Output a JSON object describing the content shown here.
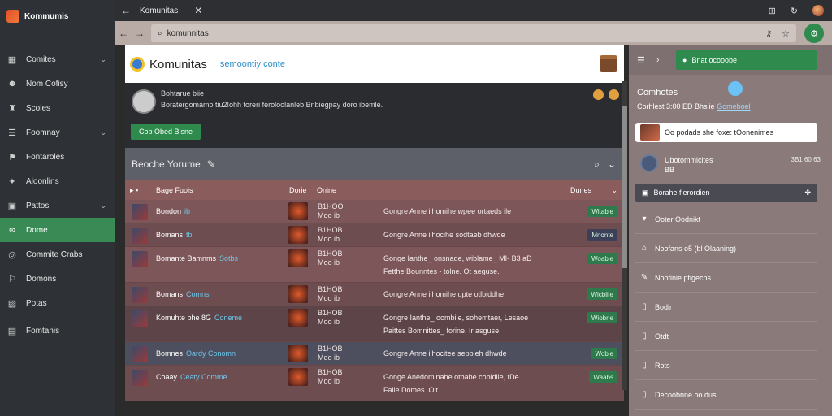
{
  "sidebar": {
    "brand": "Kommumis",
    "items": [
      {
        "label": "Comites",
        "icon": "grid-icon",
        "chev": true
      },
      {
        "label": "Nom Cofisy",
        "icon": "users-icon",
        "chev": false
      },
      {
        "label": "Scoles",
        "icon": "trophy-icon",
        "chev": false
      },
      {
        "label": "Foomnay",
        "icon": "list-icon",
        "chev": true
      },
      {
        "label": "Fontaroles",
        "icon": "tag-icon",
        "chev": false
      },
      {
        "label": "Aloonlins",
        "icon": "star-icon",
        "chev": false
      },
      {
        "label": "Pattos",
        "icon": "box-icon",
        "chev": true
      },
      {
        "label": "Dome",
        "icon": "link-icon",
        "chev": false,
        "active": true
      },
      {
        "label": "Commite Crabs",
        "icon": "circle-icon",
        "chev": false
      },
      {
        "label": "Domons",
        "icon": "flag-icon",
        "chev": false
      },
      {
        "label": "Potas",
        "icon": "image-icon",
        "chev": false
      },
      {
        "label": "Fomtanis",
        "icon": "chat-icon",
        "chev": false
      }
    ]
  },
  "browser": {
    "tab_title": "Komunitas",
    "url": "komunnitas"
  },
  "site": {
    "title": "Komunitas",
    "tagline": "semoontiy conte"
  },
  "profile": {
    "name": "Bohtarue biie",
    "desc": "Boratergomamo tiu2!ohh toreri feroloolanleb Bnbiegpay doro ibemle.",
    "join_label": "Cob Obed Bisne"
  },
  "search": {
    "label": "Beoche Yorume"
  },
  "table": {
    "headers": [
      "Bage Fuois",
      "Dorie",
      "Onine",
      "Dunes"
    ],
    "rows": [
      {
        "name": "Bondon",
        "tag": "ib",
        "stats1": "B1HOO",
        "stats2": "Moo ib",
        "desc": "Gongre Anne ilhomihe wpee ortaeds ile",
        "badge": "Witable"
      },
      {
        "name": "Bomans",
        "tag": "tb",
        "stats1": "B1HOB",
        "stats2": "Moo ib",
        "desc": "Gongre Anne ilhocihe sodtaeb dhwde",
        "badge": "Mnonte"
      },
      {
        "name": "Bomante Bamnms",
        "tag": "Sotbs",
        "stats1": "B1HOB",
        "stats2": "Moo ib",
        "desc": "Gonge Ianthe_ onsnade, wiblame_ MI- B3 aD",
        "desc2": "Fetthe Bounntes - tolne. Ot aeguse.",
        "badge": "Woable"
      },
      {
        "name": "Bomans",
        "tag": "Comns",
        "stats1": "B1HOB",
        "stats2": "Moo ib",
        "desc": "Gongre Anne ilhomihe upte otlbiddhe",
        "badge": "Wicbiile"
      },
      {
        "name": "Komuhte bhe 8G",
        "tag": "Coneme",
        "stats1": "B1HOB",
        "stats2": "Moo ib",
        "desc": "Gongre Ianthe_ oombile, sohemtaer, Lesaoe",
        "desc2": "Paittes Bomnittes_ forine. Ir asguse.",
        "badge": "Wiobrie"
      },
      {
        "name": "Bomnes",
        "tag": "Oardy Conomn",
        "stats1": "B1HOB",
        "stats2": "Moo ib",
        "desc": "Gongre Anne ilhocitee sepbieh dhwde",
        "badge": "Woble"
      },
      {
        "name": "Coaay",
        "tag": "Ceaty Comme",
        "stats1": "B1HOB",
        "stats2": "Moo ib",
        "desc": "Gonge Anedominahe otbabe cobidlie, tDe",
        "desc2": "Falle Domes. Oit",
        "badge": "Waabs"
      }
    ]
  },
  "right": {
    "tab_label": "Bnat ocooobe",
    "section_title": "Comhotes",
    "sub_text": "Corhlest 3:00 ED Bhslie",
    "sub_link": "Gomeboel",
    "notice": "Oo podads she foxe: tOonenimes",
    "community_name": "Ubotommicites",
    "community_meta": "BB",
    "community_time": "3B1 60 63",
    "bar_label": "Borahe fierordien",
    "list": [
      {
        "label": "Ooter Oodnikt",
        "icon": "chevron-down-icon"
      },
      {
        "label": "Noofans o5 (bl Olaaning)",
        "icon": "home-icon"
      },
      {
        "label": "Noofinie ptigechs",
        "icon": "edit-icon"
      },
      {
        "label": "Bodir",
        "icon": "doc-icon"
      },
      {
        "label": "Otdt",
        "icon": "doc-icon"
      },
      {
        "label": "Rots",
        "icon": "doc-icon"
      },
      {
        "label": "Decoobnne oo dus",
        "icon": "doc-icon"
      }
    ]
  }
}
